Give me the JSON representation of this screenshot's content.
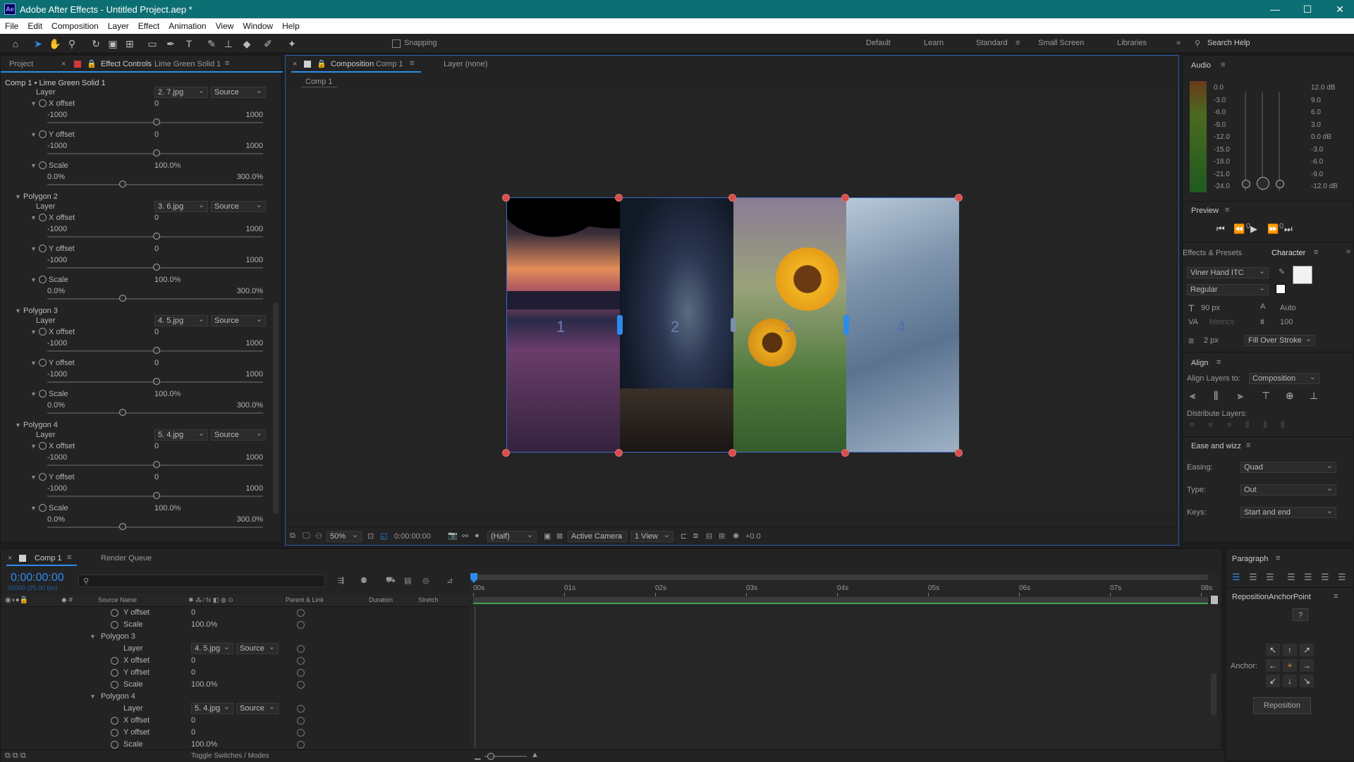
{
  "app": {
    "title": "Adobe After Effects - Untitled Project.aep *",
    "icon": "Ae"
  },
  "menu": [
    "File",
    "Edit",
    "Composition",
    "Layer",
    "Effect",
    "Animation",
    "View",
    "Window",
    "Help"
  ],
  "toolbar": {
    "snapping": "Snapping",
    "workspaces": [
      "Default",
      "Learn",
      "Standard",
      "Small Screen",
      "Libraries"
    ],
    "active_workspace": "Standard",
    "search_placeholder": "Search Help"
  },
  "left_panel": {
    "tab_project": "Project",
    "tab_effect_controls": "Effect Controls",
    "effect_target": "Lime Green Solid 1",
    "header": "Comp 1 • Lime Green Solid 1",
    "labels": {
      "layer": "Layer",
      "source": "Source",
      "x_offset": "X offset",
      "y_offset": "Y offset",
      "scale": "Scale",
      "min": "-1000",
      "max": "1000",
      "smin": "0.0%",
      "smax": "300.0%",
      "zero": "0",
      "scale_val": "100.0",
      "pct": "%"
    },
    "groups": [
      {
        "name": "",
        "layer": "2. 7.jpg"
      },
      {
        "name": "Polygon 2",
        "layer": "3. 6.jpg"
      },
      {
        "name": "Polygon 3",
        "layer": "4. 5.jpg"
      },
      {
        "name": "Polygon 4",
        "layer": "5. 4.jpg"
      }
    ]
  },
  "comp_panel": {
    "tab": "Composition",
    "comp_name": "Comp 1",
    "layer_tab": "Layer (none)",
    "crumb": "Comp 1",
    "panels": [
      "1",
      "2",
      "3",
      "4"
    ],
    "bottom": {
      "zoom": "50%",
      "time": "0:00:00:00",
      "resolution": "(Half)",
      "camera": "Active Camera",
      "views": "1 View",
      "exposure": "+0.0"
    }
  },
  "audio": {
    "title": "Audio",
    "left": [
      "0.0",
      "-3.0",
      "-6.0",
      "-9.0",
      "-12.0",
      "-15.0",
      "-18.0",
      "-21.0",
      "-24.0"
    ],
    "right": [
      "12.0 dB",
      "9.0",
      "6.0",
      "3.0",
      "0.0 dB",
      "-3.0",
      "-6.0",
      "-9.0",
      "-12.0 dB"
    ],
    "left_bottom": "0",
    "right_bottom": "0"
  },
  "preview": {
    "title": "Preview"
  },
  "character": {
    "tab_effects": "Effects & Presets",
    "tab_character": "Character",
    "font": "Viner Hand ITC",
    "style": "Regular",
    "size": "90 px",
    "leading": "Auto",
    "kerning": "Metrics",
    "tracking": "100",
    "stroke": "2 px",
    "stroke_mode": "Fill Over Stroke"
  },
  "align": {
    "title": "Align",
    "align_to_label": "Align Layers to:",
    "align_to": "Composition",
    "distribute": "Distribute Layers:"
  },
  "ease": {
    "title": "Ease and wizz",
    "easing_label": "Easing:",
    "easing": "Quad",
    "type_label": "Type:",
    "type": "Out",
    "keys_label": "Keys:",
    "keys": "Start and end"
  },
  "timeline": {
    "tab": "Comp 1",
    "render_queue": "Render Queue",
    "timecode": "0:00:00:00",
    "fps": "00000 (25.00 fps)",
    "cols": {
      "source": "Source Name",
      "parent": "Parent & Link",
      "duration": "Duration",
      "stretch": "Stretch"
    },
    "ruler": [
      "00s",
      "01s",
      "02s",
      "03s",
      "04s",
      "05s",
      "06s",
      "07s",
      "08s"
    ],
    "toggle": "Toggle Switches / Modes",
    "rows": [
      {
        "indent": 2,
        "label": "Y offset",
        "value": "0",
        "stopwatch": true
      },
      {
        "indent": 2,
        "label": "Scale",
        "value": "100.0%",
        "stopwatch": true
      },
      {
        "indent": 1,
        "label": "Polygon 3",
        "group": true
      },
      {
        "indent": 2,
        "label": "Layer",
        "dropdown": "4. 5.jpg",
        "src": "Source"
      },
      {
        "indent": 2,
        "label": "X offset",
        "value": "0",
        "stopwatch": true
      },
      {
        "indent": 2,
        "label": "Y offset",
        "value": "0",
        "stopwatch": true
      },
      {
        "indent": 2,
        "label": "Scale",
        "value": "100.0%",
        "stopwatch": true
      },
      {
        "indent": 1,
        "label": "Polygon 4",
        "group": true
      },
      {
        "indent": 2,
        "label": "Layer",
        "dropdown": "5. 4.jpg",
        "src": "Source"
      },
      {
        "indent": 2,
        "label": "X offset",
        "value": "0",
        "stopwatch": true
      },
      {
        "indent": 2,
        "label": "Y offset",
        "value": "0",
        "stopwatch": true
      },
      {
        "indent": 2,
        "label": "Scale",
        "value": "100.0%",
        "stopwatch": true
      }
    ]
  },
  "paragraph": {
    "title": "Paragraph"
  },
  "reposition": {
    "title": "RepositionAnchorPoint",
    "help": "?",
    "anchor_label": "Anchor:",
    "button": "Reposition"
  }
}
